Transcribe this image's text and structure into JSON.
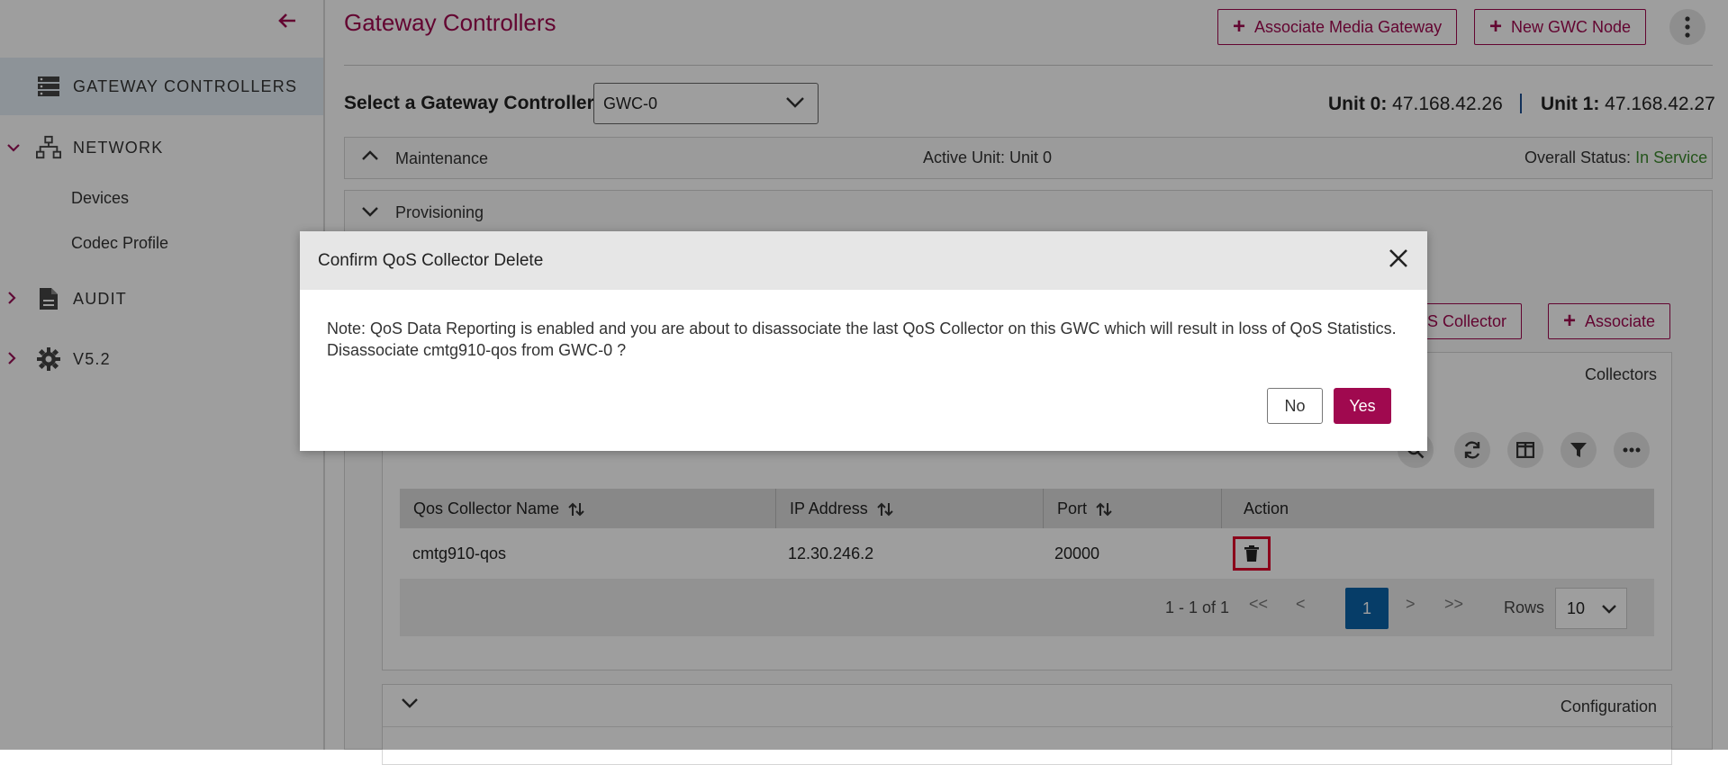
{
  "sidebar": {
    "items": [
      {
        "label": "GATEWAY CONTROLLERS",
        "icon": "server-stack-icon"
      },
      {
        "label": "NETWORK",
        "icon": "network-icon"
      },
      {
        "label": "AUDIT",
        "icon": "document-icon"
      },
      {
        "label": "V5.2",
        "icon": "gear-icon"
      }
    ],
    "network_subitems": [
      "Devices",
      "Codec Profile"
    ]
  },
  "header": {
    "title": "Gateway Controllers",
    "associate_media_gateway_label": "Associate Media Gateway",
    "new_gwc_node_label": "New GWC Node"
  },
  "selector": {
    "label": "Select a Gateway Controller:",
    "value": "GWC-0"
  },
  "units": {
    "unit0_label": "Unit 0:",
    "unit0_ip": "47.168.42.26",
    "unit1_label": "Unit 1:",
    "unit1_ip": "47.168.42.27"
  },
  "maintenance": {
    "title": "Maintenance",
    "active_unit": "Active Unit: Unit 0",
    "overall_status_label": "Overall Status:",
    "overall_status_value": "In Service"
  },
  "provisioning": {
    "title": "Provisioning",
    "qos_collector_btn": "QoS Collector",
    "associate_btn": "Associate",
    "collectors_title": "Collectors",
    "table": {
      "columns": [
        "Qos Collector Name",
        "IP Address",
        "Port",
        "Action"
      ],
      "rows": [
        {
          "name": "cmtg910-qos",
          "ip": "12.30.246.2",
          "port": "20000"
        }
      ]
    },
    "pagination": {
      "range": "1 - 1 of 1",
      "first": "<<",
      "prev": "<",
      "current": "1",
      "next": ">",
      "last": ">>",
      "rows_label": "Rows",
      "rows_value": "10"
    },
    "configuration_title": "Configuration"
  },
  "dialog": {
    "title": "Confirm QoS Collector Delete",
    "line1": "Note: QoS Data Reporting is enabled and you are about to disassociate the last QoS Collector on this GWC which will result in loss of QoS Statistics.",
    "line2": "Disassociate cmtg910-qos from GWC-0 ?",
    "no_label": "No",
    "yes_label": "Yes"
  },
  "colors": {
    "brand": "#a0094f",
    "status_green": "#3c8a2e",
    "page_active": "#0b63a8",
    "highlight": "#e0002a"
  }
}
